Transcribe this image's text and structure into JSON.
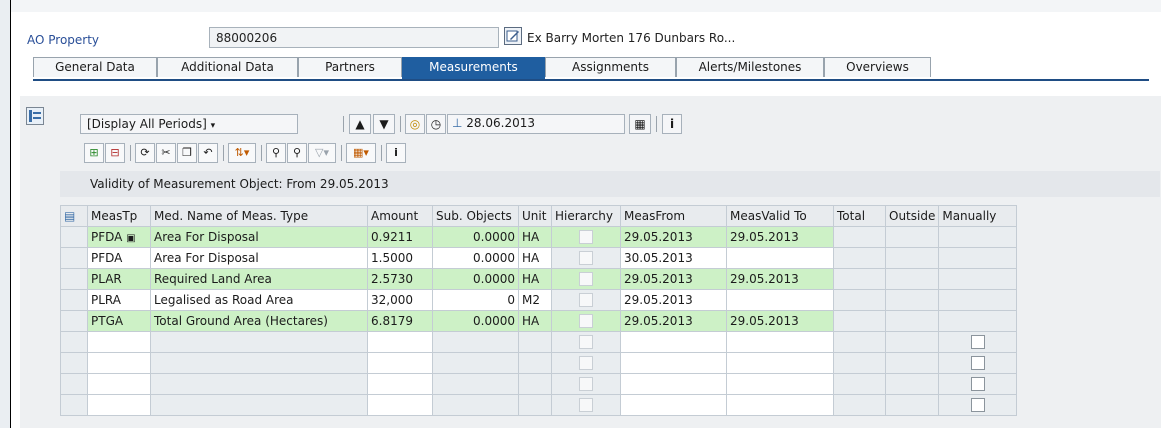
{
  "header": {
    "ao_label": "AO Property",
    "ao_number": "88000206",
    "ao_description": "Ex Barry Morten 176 Dunbars Ro..."
  },
  "tabs": [
    {
      "label": "General Data"
    },
    {
      "label": "Additional Data"
    },
    {
      "label": "Partners"
    },
    {
      "label": "Measurements",
      "active": true
    },
    {
      "label": "Assignments"
    },
    {
      "label": "Alerts/Milestones"
    },
    {
      "label": "Overviews"
    }
  ],
  "toolbar": {
    "period": "[Display All Periods]",
    "date": "28.06.2013"
  },
  "validity_text": "Validity of Measurement Object: From 29.05.2013",
  "columns": [
    "MeasTp",
    "Med. Name of Meas. Type",
    "Amount",
    "Sub. Objects",
    "Unit",
    "Hierarchy",
    "MeasFrom",
    "MeasValid To",
    "Total",
    "Outside",
    "Manually"
  ],
  "rows": [
    {
      "type": "PFDA",
      "name": "Area For Disposal",
      "amount": "0.9211",
      "sub": "0.0000",
      "unit": "HA",
      "from": "29.05.2013",
      "to": "29.05.2013"
    },
    {
      "type": "PFDA",
      "name": "Area For Disposal",
      "amount": "1.5000",
      "sub": "0.0000",
      "unit": "HA",
      "from": "30.05.2013",
      "to": ""
    },
    {
      "type": "PLAR",
      "name": "Required Land Area",
      "amount": "2.5730",
      "sub": "0.0000",
      "unit": "HA",
      "from": "29.05.2013",
      "to": "29.05.2013"
    },
    {
      "type": "PLRA",
      "name": "Legalised as Road Area",
      "amount": "32,000",
      "sub": "0",
      "unit": "M2",
      "from": "29.05.2013",
      "to": ""
    },
    {
      "type": "PTGA",
      "name": "Total Ground Area (Hectares)",
      "amount": "6.8179",
      "sub": "0.0000",
      "unit": "HA",
      "from": "29.05.2013",
      "to": "29.05.2013"
    }
  ],
  "colors": {
    "highlight_row": "#cdf1c6",
    "active_tab": "#1f5ea0"
  }
}
